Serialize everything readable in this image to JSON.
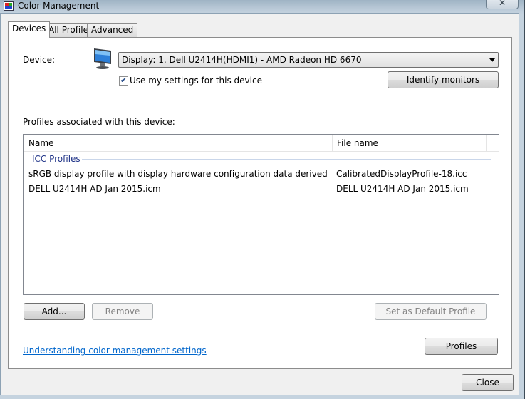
{
  "window": {
    "title": "Color Management",
    "close_glyph": "✕"
  },
  "tabs": [
    {
      "label": "Devices",
      "active": true
    },
    {
      "label": "All Profiles",
      "active": false
    },
    {
      "label": "Advanced",
      "active": false
    }
  ],
  "device": {
    "label": "Device:",
    "icon": "monitor-icon",
    "selected": "Display: 1. Dell U2414H(HDMI1) - AMD Radeon HD 6670",
    "use_my_settings_label": "Use my settings for this device",
    "use_my_settings_checked": true,
    "identify_label": "Identify monitors"
  },
  "profiles": {
    "section_label": "Profiles associated with this device:",
    "columns": [
      "Name",
      "File name"
    ],
    "group": "ICC Profiles",
    "rows": [
      {
        "name": "sRGB display profile with display hardware configuration data derived from cali...",
        "file": "CalibratedDisplayProfile-18.icc"
      },
      {
        "name": "DELL U2414H AD Jan 2015.icm",
        "file": "DELL U2414H AD Jan 2015.icm"
      }
    ]
  },
  "buttons": {
    "add": "Add...",
    "remove": "Remove",
    "set_default": "Set as Default Profile",
    "profiles": "Profiles",
    "close": "Close"
  },
  "link": "Understanding color management settings",
  "colors": {
    "link": "#0066cc",
    "group_label": "#1e3287",
    "title_bar": "#b9c9d7"
  }
}
